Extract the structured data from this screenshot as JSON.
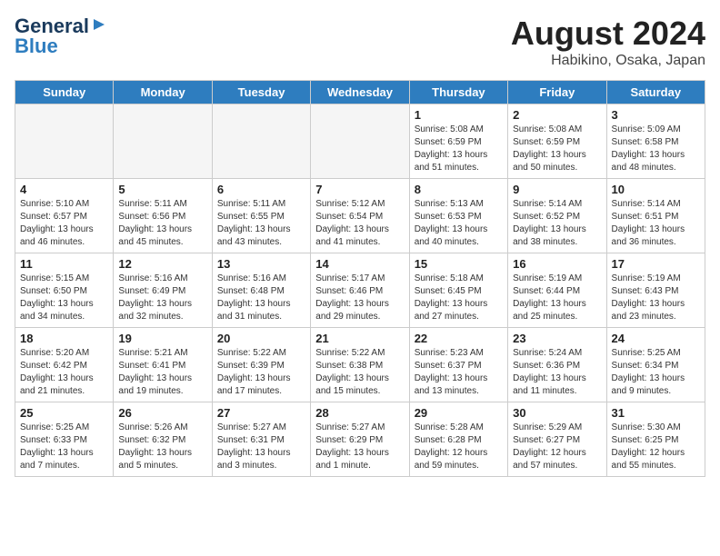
{
  "logo": {
    "text1": "General",
    "text2": "Blue"
  },
  "header": {
    "month_year": "August 2024",
    "location": "Habikino, Osaka, Japan"
  },
  "weekdays": [
    "Sunday",
    "Monday",
    "Tuesday",
    "Wednesday",
    "Thursday",
    "Friday",
    "Saturday"
  ],
  "weeks": [
    [
      {
        "day": "",
        "info": ""
      },
      {
        "day": "",
        "info": ""
      },
      {
        "day": "",
        "info": ""
      },
      {
        "day": "",
        "info": ""
      },
      {
        "day": "1",
        "info": "Sunrise: 5:08 AM\nSunset: 6:59 PM\nDaylight: 13 hours\nand 51 minutes."
      },
      {
        "day": "2",
        "info": "Sunrise: 5:08 AM\nSunset: 6:59 PM\nDaylight: 13 hours\nand 50 minutes."
      },
      {
        "day": "3",
        "info": "Sunrise: 5:09 AM\nSunset: 6:58 PM\nDaylight: 13 hours\nand 48 minutes."
      }
    ],
    [
      {
        "day": "4",
        "info": "Sunrise: 5:10 AM\nSunset: 6:57 PM\nDaylight: 13 hours\nand 46 minutes."
      },
      {
        "day": "5",
        "info": "Sunrise: 5:11 AM\nSunset: 6:56 PM\nDaylight: 13 hours\nand 45 minutes."
      },
      {
        "day": "6",
        "info": "Sunrise: 5:11 AM\nSunset: 6:55 PM\nDaylight: 13 hours\nand 43 minutes."
      },
      {
        "day": "7",
        "info": "Sunrise: 5:12 AM\nSunset: 6:54 PM\nDaylight: 13 hours\nand 41 minutes."
      },
      {
        "day": "8",
        "info": "Sunrise: 5:13 AM\nSunset: 6:53 PM\nDaylight: 13 hours\nand 40 minutes."
      },
      {
        "day": "9",
        "info": "Sunrise: 5:14 AM\nSunset: 6:52 PM\nDaylight: 13 hours\nand 38 minutes."
      },
      {
        "day": "10",
        "info": "Sunrise: 5:14 AM\nSunset: 6:51 PM\nDaylight: 13 hours\nand 36 minutes."
      }
    ],
    [
      {
        "day": "11",
        "info": "Sunrise: 5:15 AM\nSunset: 6:50 PM\nDaylight: 13 hours\nand 34 minutes."
      },
      {
        "day": "12",
        "info": "Sunrise: 5:16 AM\nSunset: 6:49 PM\nDaylight: 13 hours\nand 32 minutes."
      },
      {
        "day": "13",
        "info": "Sunrise: 5:16 AM\nSunset: 6:48 PM\nDaylight: 13 hours\nand 31 minutes."
      },
      {
        "day": "14",
        "info": "Sunrise: 5:17 AM\nSunset: 6:46 PM\nDaylight: 13 hours\nand 29 minutes."
      },
      {
        "day": "15",
        "info": "Sunrise: 5:18 AM\nSunset: 6:45 PM\nDaylight: 13 hours\nand 27 minutes."
      },
      {
        "day": "16",
        "info": "Sunrise: 5:19 AM\nSunset: 6:44 PM\nDaylight: 13 hours\nand 25 minutes."
      },
      {
        "day": "17",
        "info": "Sunrise: 5:19 AM\nSunset: 6:43 PM\nDaylight: 13 hours\nand 23 minutes."
      }
    ],
    [
      {
        "day": "18",
        "info": "Sunrise: 5:20 AM\nSunset: 6:42 PM\nDaylight: 13 hours\nand 21 minutes."
      },
      {
        "day": "19",
        "info": "Sunrise: 5:21 AM\nSunset: 6:41 PM\nDaylight: 13 hours\nand 19 minutes."
      },
      {
        "day": "20",
        "info": "Sunrise: 5:22 AM\nSunset: 6:39 PM\nDaylight: 13 hours\nand 17 minutes."
      },
      {
        "day": "21",
        "info": "Sunrise: 5:22 AM\nSunset: 6:38 PM\nDaylight: 13 hours\nand 15 minutes."
      },
      {
        "day": "22",
        "info": "Sunrise: 5:23 AM\nSunset: 6:37 PM\nDaylight: 13 hours\nand 13 minutes."
      },
      {
        "day": "23",
        "info": "Sunrise: 5:24 AM\nSunset: 6:36 PM\nDaylight: 13 hours\nand 11 minutes."
      },
      {
        "day": "24",
        "info": "Sunrise: 5:25 AM\nSunset: 6:34 PM\nDaylight: 13 hours\nand 9 minutes."
      }
    ],
    [
      {
        "day": "25",
        "info": "Sunrise: 5:25 AM\nSunset: 6:33 PM\nDaylight: 13 hours\nand 7 minutes."
      },
      {
        "day": "26",
        "info": "Sunrise: 5:26 AM\nSunset: 6:32 PM\nDaylight: 13 hours\nand 5 minutes."
      },
      {
        "day": "27",
        "info": "Sunrise: 5:27 AM\nSunset: 6:31 PM\nDaylight: 13 hours\nand 3 minutes."
      },
      {
        "day": "28",
        "info": "Sunrise: 5:27 AM\nSunset: 6:29 PM\nDaylight: 13 hours\nand 1 minute."
      },
      {
        "day": "29",
        "info": "Sunrise: 5:28 AM\nSunset: 6:28 PM\nDaylight: 12 hours\nand 59 minutes."
      },
      {
        "day": "30",
        "info": "Sunrise: 5:29 AM\nSunset: 6:27 PM\nDaylight: 12 hours\nand 57 minutes."
      },
      {
        "day": "31",
        "info": "Sunrise: 5:30 AM\nSunset: 6:25 PM\nDaylight: 12 hours\nand 55 minutes."
      }
    ]
  ]
}
